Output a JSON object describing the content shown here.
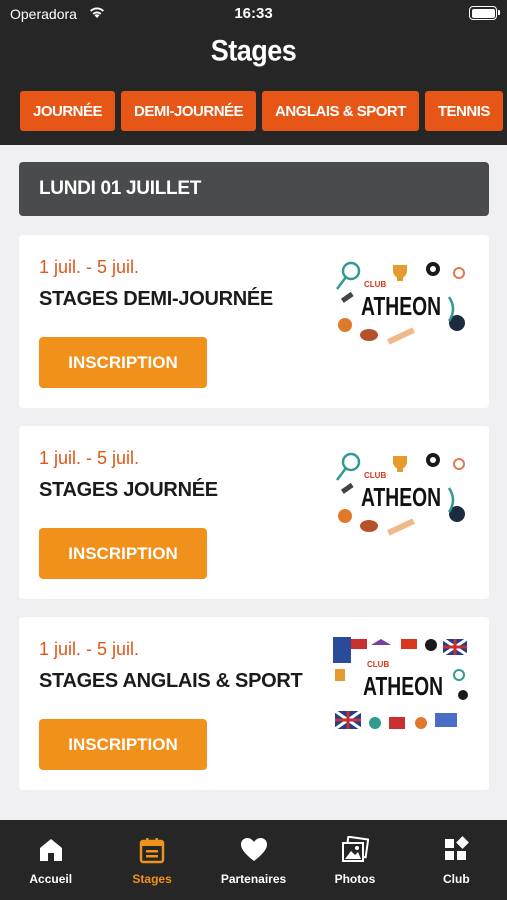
{
  "status": {
    "carrier": "Operadora",
    "time": "16:33"
  },
  "header": {
    "title": "Stages"
  },
  "filters": [
    "JOURNÉE",
    "DEMI-JOURNÉE",
    "ANGLAIS & SPORT",
    "TENNIS"
  ],
  "day": {
    "label": "LUNDI 01 JUILLET"
  },
  "stages": [
    {
      "dates": "1 juil. - 5 juil.",
      "name": "STAGES DEMI-JOURNÉE",
      "button": "INSCRIPTION",
      "image_text": {
        "club": "CLUB",
        "brand": "ATHEON"
      }
    },
    {
      "dates": "1 juil. - 5 juil.",
      "name": "STAGES JOURNÉE",
      "button": "INSCRIPTION",
      "image_text": {
        "club": "CLUB",
        "brand": "ATHEON"
      }
    },
    {
      "dates": "1 juil. - 5 juil.",
      "name": "STAGES ANGLAIS & SPORT",
      "button": "INSCRIPTION",
      "image_text": {
        "club": "CLUB",
        "brand": "ATHEON"
      }
    }
  ],
  "tabs": [
    {
      "label": "Accueil",
      "icon": "home-icon"
    },
    {
      "label": "Stages",
      "icon": "calendar-icon",
      "active": true
    },
    {
      "label": "Partenaires",
      "icon": "heart-icon"
    },
    {
      "label": "Photos",
      "icon": "photos-icon"
    },
    {
      "label": "Club",
      "icon": "club-icon"
    }
  ],
  "colors": {
    "accent": "#e65616",
    "button": "#f0911b",
    "dark": "#262626",
    "date": "#e0571a"
  }
}
